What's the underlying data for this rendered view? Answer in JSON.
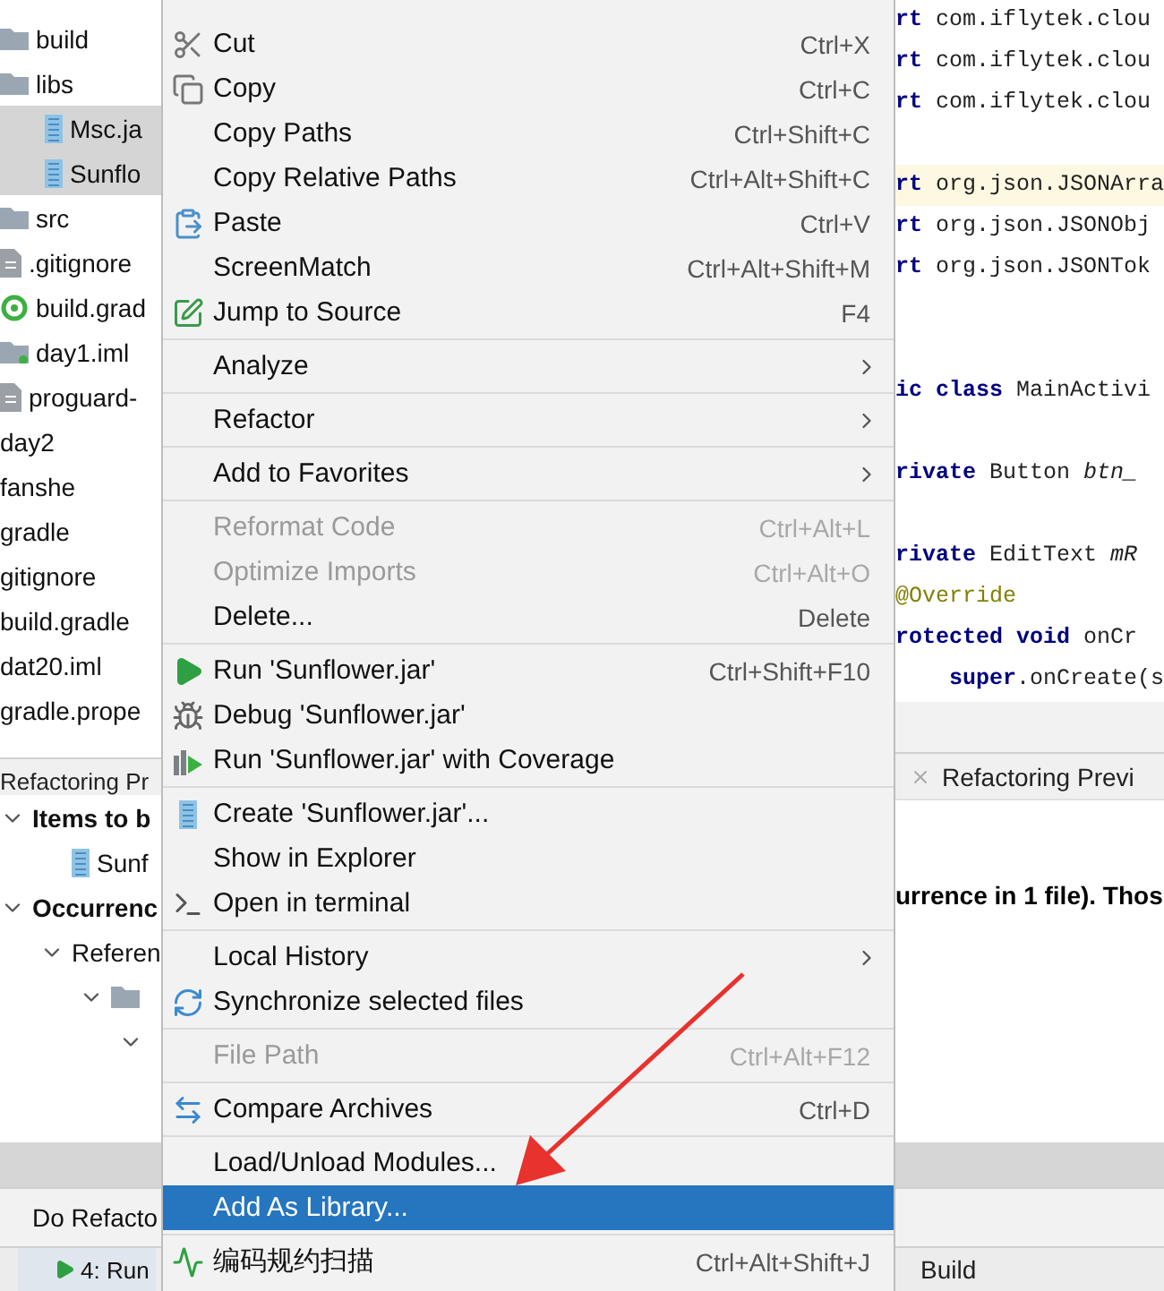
{
  "project_tree": [
    {
      "children": [
        {
          "label": "build",
          "kind": "folder",
          "selected": false
        },
        {
          "label": "libs",
          "kind": "folder",
          "selected": false,
          "children": [
            {
              "label": "Msc.ja",
              "kind": "jar",
              "selected": true
            },
            {
              "label": "Sunflo",
              "kind": "jar",
              "selected": true
            }
          ]
        },
        {
          "label": "src",
          "kind": "folder",
          "selected": false
        },
        {
          "label": ".gitignore",
          "kind": "file",
          "selected": false
        },
        {
          "label": "build.grad",
          "kind": "gradle",
          "selected": false
        },
        {
          "label": "day1.iml",
          "kind": "module",
          "selected": false
        },
        {
          "label": "proguard-",
          "kind": "file",
          "selected": false
        }
      ]
    },
    {
      "label": "day2",
      "selected": false
    },
    {
      "label": "fanshe",
      "selected": false
    },
    {
      "label": "gradle",
      "selected": false
    },
    {
      "label": "gitignore",
      "selected": false
    },
    {
      "label": "build.gradle",
      "selected": false
    },
    {
      "label": "dat20.iml",
      "selected": false
    },
    {
      "label": "gradle.prope",
      "selected": false
    }
  ],
  "refactoring_panel": {
    "title": "Refactoring Pr",
    "tree": [
      {
        "label": "Items to b",
        "expanded": true,
        "children": [
          {
            "label": "Sunf",
            "kind": "jar"
          }
        ]
      },
      {
        "label": "Occurrenc",
        "expanded": true,
        "children": [
          {
            "label": "Referen",
            "expanded": true,
            "children": [
              {
                "kind": "folder",
                "expanded": true,
                "children": [
                  {
                    "expanded": true
                  }
                ]
              }
            ]
          }
        ]
      }
    ],
    "do_refactor_button": "Do Refacto",
    "run_tab": "4: Run"
  },
  "context_menu": [
    [
      {
        "label": "Cut",
        "shortcut": "Ctrl+X",
        "disabled": false,
        "selected": false,
        "submenu": false
      },
      {
        "label": "Copy",
        "shortcut": "Ctrl+C",
        "disabled": false,
        "selected": false,
        "submenu": false
      },
      {
        "label": "Copy Paths",
        "shortcut": "Ctrl+Shift+C",
        "disabled": false,
        "selected": false,
        "submenu": false
      },
      {
        "label": "Copy Relative Paths",
        "shortcut": "Ctrl+Alt+Shift+C",
        "disabled": false,
        "selected": false,
        "submenu": false
      },
      {
        "label": "Paste",
        "shortcut": "Ctrl+V",
        "disabled": false,
        "selected": false,
        "submenu": false
      },
      {
        "label": "ScreenMatch",
        "shortcut": "Ctrl+Alt+Shift+M",
        "disabled": false,
        "selected": false,
        "submenu": false
      },
      {
        "label": "Jump to Source",
        "shortcut": "F4",
        "disabled": false,
        "selected": false,
        "submenu": false
      }
    ],
    [
      {
        "label": "Analyze",
        "disabled": false,
        "selected": false,
        "submenu": true
      }
    ],
    [
      {
        "label": "Refactor",
        "disabled": false,
        "selected": false,
        "submenu": true
      }
    ],
    [
      {
        "label": "Add to Favorites",
        "disabled": false,
        "selected": false,
        "submenu": true
      }
    ],
    [
      {
        "label": "Reformat Code",
        "shortcut": "Ctrl+Alt+L",
        "disabled": true,
        "selected": false,
        "submenu": false
      },
      {
        "label": "Optimize Imports",
        "shortcut": "Ctrl+Alt+O",
        "disabled": true,
        "selected": false,
        "submenu": false
      },
      {
        "label": "Delete...",
        "shortcut": "Delete",
        "disabled": false,
        "selected": false,
        "submenu": false
      }
    ],
    [
      {
        "label": "Run 'Sunflower.jar'",
        "shortcut": "Ctrl+Shift+F10",
        "disabled": false,
        "selected": false,
        "submenu": false
      },
      {
        "label": "Debug 'Sunflower.jar'",
        "disabled": false,
        "selected": false,
        "submenu": false
      },
      {
        "label": "Run 'Sunflower.jar' with Coverage",
        "disabled": false,
        "selected": false,
        "submenu": false
      }
    ],
    [
      {
        "label": "Create 'Sunflower.jar'...",
        "disabled": false,
        "selected": false,
        "submenu": false
      },
      {
        "label": "Show in Explorer",
        "disabled": false,
        "selected": false,
        "submenu": false
      },
      {
        "label": "Open in terminal",
        "disabled": false,
        "selected": false,
        "submenu": false
      }
    ],
    [
      {
        "label": "Local History",
        "disabled": false,
        "selected": false,
        "submenu": true
      },
      {
        "label": "Synchronize selected files",
        "disabled": false,
        "selected": false,
        "submenu": false
      }
    ],
    [
      {
        "label": "File Path",
        "shortcut": "Ctrl+Alt+F12",
        "disabled": true,
        "selected": false,
        "submenu": false
      }
    ],
    [
      {
        "label": "Compare Archives",
        "shortcut": "Ctrl+D",
        "disabled": false,
        "selected": false,
        "submenu": false
      }
    ],
    [
      {
        "label": "Load/Unload Modules...",
        "disabled": false,
        "selected": false,
        "submenu": false
      },
      {
        "label": "Add As Library...",
        "disabled": false,
        "selected": true,
        "submenu": false
      }
    ],
    [
      {
        "label": "编码规约扫描",
        "shortcut": "Ctrl+Alt+Shift+J",
        "disabled": false,
        "selected": false,
        "submenu": false
      }
    ]
  ],
  "code_lines": [
    {
      "kind": "code",
      "text": "**rt** com.iflytek.clou",
      "highlighted": false
    },
    {
      "kind": "code",
      "text": "**rt** com.iflytek.clou",
      "highlighted": false
    },
    {
      "kind": "code",
      "text": "**rt** com.iflytek.clou",
      "highlighted": false
    },
    {
      "kind": "blank"
    },
    {
      "kind": "code",
      "text": "**rt** org.json.JSONArra",
      "highlighted": true
    },
    {
      "kind": "code",
      "text": "**rt** org.json.JSONObj",
      "highlighted": false
    },
    {
      "kind": "code",
      "text": "**rt** org.json.JSONTok",
      "highlighted": false
    },
    {
      "kind": "blank"
    },
    {
      "kind": "blank"
    },
    {
      "kind": "code",
      "text": "**ic class** MainActivi",
      "highlighted": false
    },
    {
      "kind": "blank"
    },
    {
      "kind": "code",
      "text": "**rivate** Button *btn_*",
      "highlighted": false
    },
    {
      "kind": "blank"
    },
    {
      "kind": "code",
      "text": "**rivate** EditText *mR*",
      "highlighted": false
    },
    {
      "kind": "annotation",
      "text": "@Override",
      "highlighted": false
    },
    {
      "kind": "code",
      "text": "**rotected void** onCr",
      "highlighted": false
    },
    {
      "kind": "code",
      "text": "    **super**.onCreate(s",
      "highlighted": false
    }
  ],
  "preview_panel": {
    "tab": "Refactoring Previ",
    "message": "urrence in 1 file). Thos",
    "build_tab": "Build"
  }
}
